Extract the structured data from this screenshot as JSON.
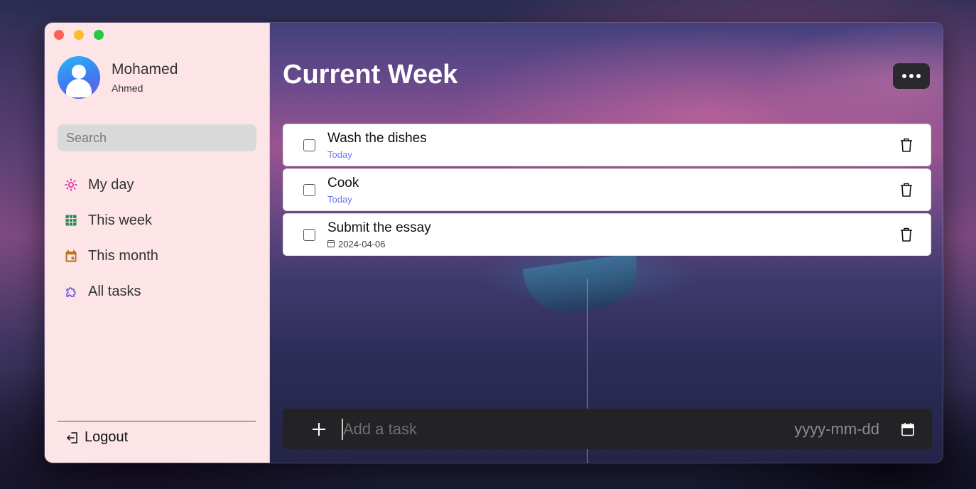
{
  "user": {
    "first_name": "Mohamed",
    "last_name": "Ahmed"
  },
  "search": {
    "placeholder": "Search"
  },
  "sidebar": {
    "items": [
      {
        "label": "My day",
        "icon": "sun-icon",
        "color": "#d81b8c"
      },
      {
        "label": "This week",
        "icon": "grid-table-icon",
        "color": "#1a8a50"
      },
      {
        "label": "This month",
        "icon": "calendar-icon",
        "color": "#b5731b"
      },
      {
        "label": "All tasks",
        "icon": "puzzle-icon",
        "color": "#5b4fe0"
      }
    ],
    "logout_label": "Logout"
  },
  "main": {
    "title": "Current Week",
    "tasks": [
      {
        "title": "Wash the dishes",
        "due": "Today"
      },
      {
        "title": "Cook",
        "due": "Today"
      },
      {
        "title": "Submit the essay",
        "due": "2024-04-06"
      }
    ],
    "add_task": {
      "placeholder": "Add a task",
      "date_placeholder": "yyyy-mm-dd"
    }
  },
  "colors": {
    "sidebar_bg": "#fde4e6",
    "today_text": "#6a73e6",
    "add_bar_bg": "#232325"
  }
}
